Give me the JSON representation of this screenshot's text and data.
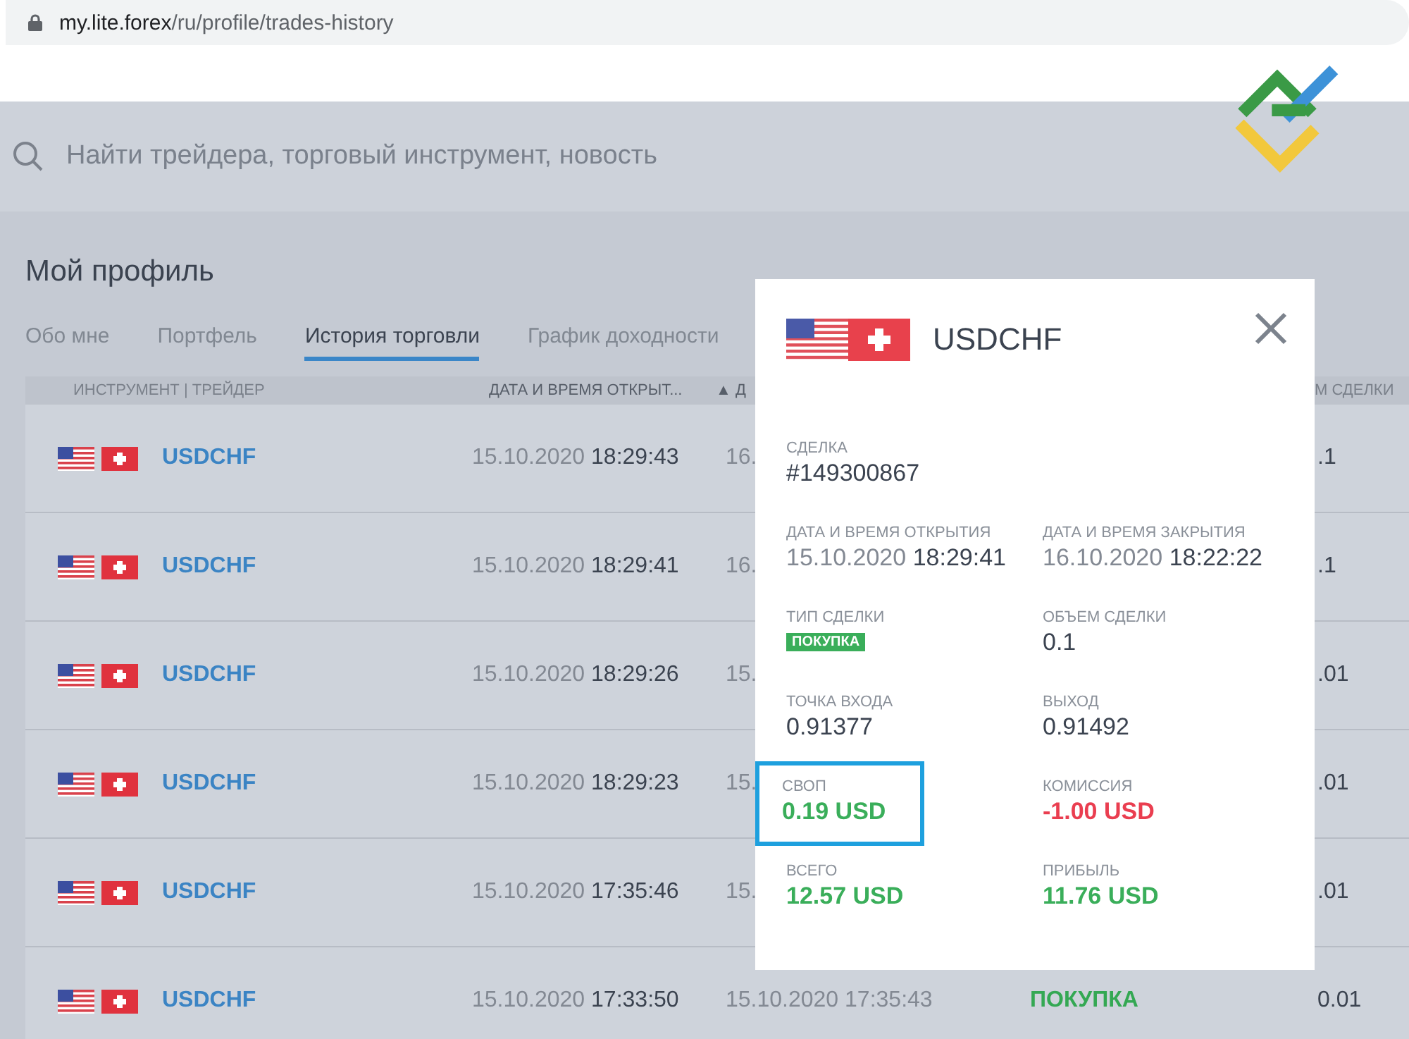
{
  "address_bar": {
    "domain": "my.lite.forex",
    "path": "/ru/profile/trades-history"
  },
  "search": {
    "placeholder": "Найти трейдера, торговый инструмент, новость"
  },
  "page_title": "Мой профиль",
  "tabs": [
    {
      "label": "Обо мне",
      "selected": false
    },
    {
      "label": "Портфель",
      "selected": false
    },
    {
      "label": "История торговли",
      "selected": true
    },
    {
      "label": "График доходности",
      "selected": false
    }
  ],
  "table": {
    "columns": [
      "ИНСТРУМЕНТ | ТРЕЙДЕР",
      "ДАТА И ВРЕМЯ ОТКРЫТ...",
      "▲ Д",
      "М СДЕЛКИ"
    ],
    "rows": [
      {
        "instrument": "USDCHF",
        "open_date": "15.10.2020",
        "open_time": "18:29:43",
        "close": "16.",
        "volume": ".1"
      },
      {
        "instrument": "USDCHF",
        "open_date": "15.10.2020",
        "open_time": "18:29:41",
        "close": "16.",
        "volume": ".1"
      },
      {
        "instrument": "USDCHF",
        "open_date": "15.10.2020",
        "open_time": "18:29:26",
        "close": "15.",
        "volume": ".01"
      },
      {
        "instrument": "USDCHF",
        "open_date": "15.10.2020",
        "open_time": "18:29:23",
        "close": "15.",
        "volume": ".01"
      },
      {
        "instrument": "USDCHF",
        "open_date": "15.10.2020",
        "open_time": "17:35:46",
        "close": "15.",
        "volume": ".01"
      },
      {
        "instrument": "USDCHF",
        "open_date": "15.10.2020",
        "open_time": "17:33:50",
        "close": "15.10.2020 17:35:43",
        "type": "ПОКУПКА",
        "volume": "0.01"
      }
    ]
  },
  "modal": {
    "title": "USDCHF",
    "fields": [
      {
        "label": "СДЕЛКА",
        "kind": "text",
        "value": "#149300867",
        "color": "#3b4350",
        "highlighted": false
      },
      {
        "label": "ДАТА И ВРЕМЯ ОТКРЫТИЯ",
        "kind": "datetime",
        "date": "15.10.2020",
        "time": "18:29:41",
        "highlighted": false
      },
      {
        "label": "ДАТА И ВРЕМЯ ЗАКРЫТИЯ",
        "kind": "datetime",
        "date": "16.10.2020",
        "time": "18:22:22",
        "highlighted": false
      },
      {
        "label": "ТИП СДЕЛКИ",
        "kind": "badge",
        "value": "ПОКУПКА",
        "highlighted": false
      },
      {
        "label": "ОБЪЕМ СДЕЛКИ",
        "kind": "text",
        "value": "0.1",
        "color": "#3b4350",
        "highlighted": false
      },
      {
        "label": "ТОЧКА ВХОДА",
        "kind": "text",
        "value": "0.91377",
        "color": "#3b4350",
        "highlighted": false
      },
      {
        "label": "ВЫХОД",
        "kind": "text",
        "value": "0.91492",
        "color": "#3b4350",
        "highlighted": false
      },
      {
        "label": "СВОП",
        "kind": "text",
        "value": "0.19 USD",
        "color": "#3aae5a",
        "highlighted": true
      },
      {
        "label": "КОМИССИЯ",
        "kind": "text",
        "value": "-1.00 USD",
        "color": "#ea3e50",
        "highlighted": false
      },
      {
        "label": "ВСЕГО",
        "kind": "text",
        "value": "12.57 USD",
        "color": "#3aae5a",
        "highlighted": false
      },
      {
        "label": "ПРИБЫЛЬ",
        "kind": "text",
        "value": "11.76 USD",
        "color": "#3aae5a",
        "highlighted": false
      }
    ]
  }
}
